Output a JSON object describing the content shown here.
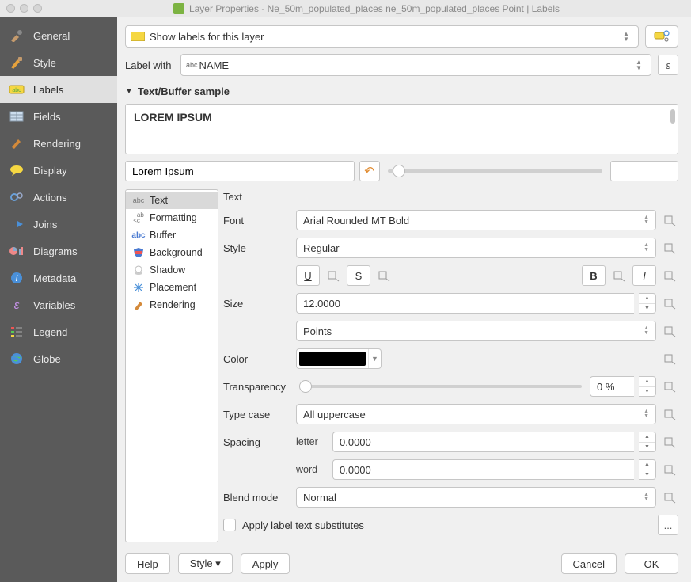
{
  "title": "Layer Properties - Ne_50m_populated_places ne_50m_populated_places Point | Labels",
  "sidebar": {
    "items": [
      {
        "label": "General"
      },
      {
        "label": "Style"
      },
      {
        "label": "Labels"
      },
      {
        "label": "Fields"
      },
      {
        "label": "Rendering"
      },
      {
        "label": "Display"
      },
      {
        "label": "Actions"
      },
      {
        "label": "Joins"
      },
      {
        "label": "Diagrams"
      },
      {
        "label": "Metadata"
      },
      {
        "label": "Variables"
      },
      {
        "label": "Legend"
      },
      {
        "label": "Globe"
      }
    ],
    "active_index": 2
  },
  "label_mode": "Show labels for this layer",
  "label_with_label": "Label with",
  "label_with_field_prefix": "abc",
  "label_with_field": "NAME",
  "expression_btn": "ε",
  "section_sample": "Text/Buffer sample",
  "sample_preview": "LOREM IPSUM",
  "sample_input": "Lorem Ipsum",
  "categories": [
    {
      "label": "Text"
    },
    {
      "label": "Formatting"
    },
    {
      "label": "Buffer"
    },
    {
      "label": "Background"
    },
    {
      "label": "Shadow"
    },
    {
      "label": "Placement"
    },
    {
      "label": "Rendering"
    }
  ],
  "active_category": 0,
  "text_panel": {
    "heading": "Text",
    "font_label": "Font",
    "font_value": "Arial Rounded MT Bold",
    "style_label": "Style",
    "style_value": "Regular",
    "underline_btn": "U",
    "strike_btn": "S",
    "bold_btn": "B",
    "italic_btn": "I",
    "size_label": "Size",
    "size_value": "12.0000",
    "size_unit": "Points",
    "color_label": "Color",
    "color_value": "#000000",
    "transparency_label": "Transparency",
    "transparency_value": "0 %",
    "typecase_label": "Type case",
    "typecase_value": "All uppercase",
    "spacing_label": "Spacing",
    "spacing_letter_label": "letter",
    "spacing_letter_value": "0.0000",
    "spacing_word_label": "word",
    "spacing_word_value": "0.0000",
    "blend_label": "Blend mode",
    "blend_value": "Normal",
    "substitutes_label": "Apply label text substitutes",
    "substitutes_btn": "..."
  },
  "footer": {
    "help": "Help",
    "style": "Style ▾",
    "apply": "Apply",
    "cancel": "Cancel",
    "ok": "OK"
  }
}
